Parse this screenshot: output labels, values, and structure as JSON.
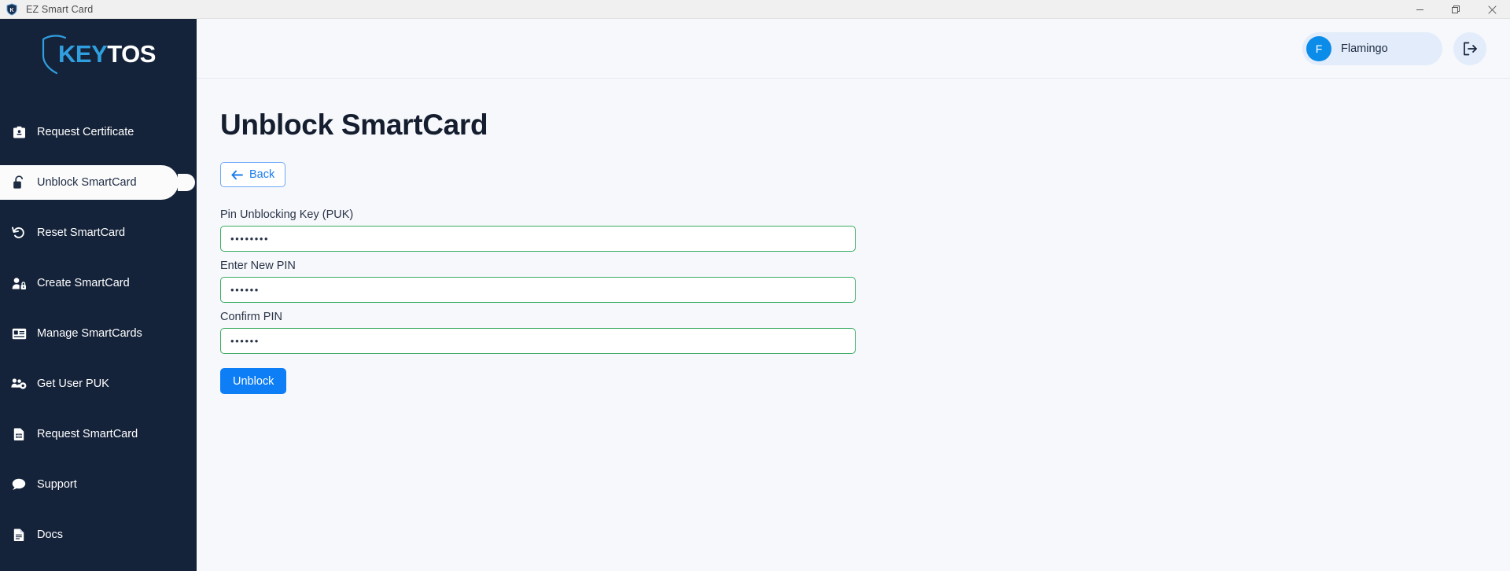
{
  "window": {
    "title": "EZ Smart Card",
    "app_icon": "shield-k-icon",
    "controls": {
      "minimize": "minimize-icon",
      "restore": "restore-icon",
      "close": "close-icon"
    }
  },
  "sidebar": {
    "logo": {
      "primary": "KEY",
      "secondary": "TOS",
      "icon": "shield-icon"
    },
    "items": [
      {
        "label": "Request Certificate",
        "icon": "certificate-badge-icon",
        "active": false
      },
      {
        "label": "Unblock SmartCard",
        "icon": "unlock-padlock-icon",
        "active": true
      },
      {
        "label": "Reset SmartCard",
        "icon": "undo-arrow-icon",
        "active": false
      },
      {
        "label": "Create SmartCard",
        "icon": "user-lock-icon",
        "active": false
      },
      {
        "label": "Manage SmartCards",
        "icon": "id-card-icon",
        "active": false
      },
      {
        "label": "Get User PUK",
        "icon": "users-gear-icon",
        "active": false
      },
      {
        "label": "Request SmartCard",
        "icon": "sim-card-icon",
        "active": false
      },
      {
        "label": "Support",
        "icon": "chat-bubble-icon",
        "active": false
      },
      {
        "label": "Docs",
        "icon": "document-icon",
        "active": false
      }
    ]
  },
  "topbar": {
    "user": {
      "initial": "F",
      "name": "Flamingo"
    },
    "logout_icon": "logout-icon"
  },
  "page": {
    "title": "Unblock SmartCard",
    "back_label": "Back",
    "back_icon": "arrow-left-icon",
    "fields": [
      {
        "label": "Pin Unblocking Key (PUK)",
        "value": "••••••••",
        "placeholder": ""
      },
      {
        "label": "Enter New PIN",
        "value": "••••••",
        "placeholder": ""
      },
      {
        "label": "Confirm PIN",
        "value": "••••••",
        "placeholder": ""
      }
    ],
    "submit_label": "Unblock"
  },
  "colors": {
    "sidebar_bg": "#15233a",
    "accent_blue": "#0d7ef5",
    "logo_blue": "#2f9fe0",
    "valid_green": "#3bab62",
    "content_bg": "#f6f8fc",
    "chip_bg": "#e3ecfa"
  }
}
